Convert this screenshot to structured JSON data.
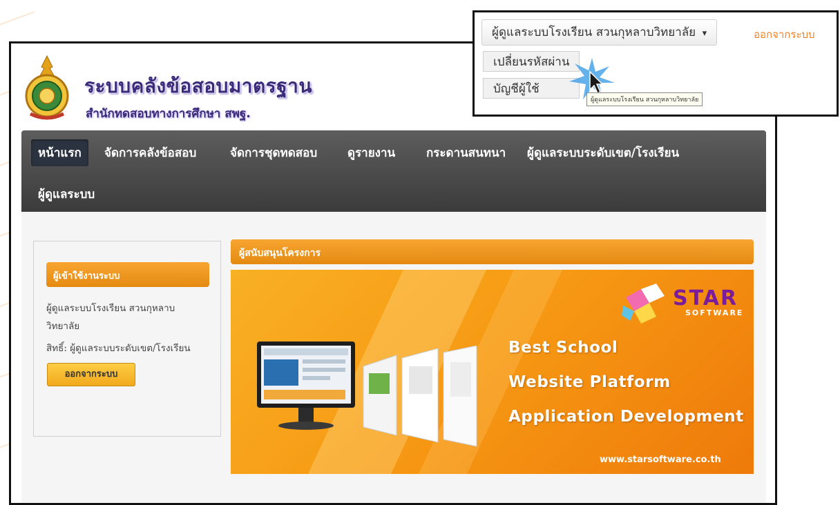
{
  "header": {
    "title": "ระบบคลังข้อสอบมาตรฐาน",
    "subtitle": "สำนักทดสอบทางการศึกษา สพฐ."
  },
  "nav": {
    "items": [
      {
        "label": "หน้าแรก",
        "active": true
      },
      {
        "label": "จัดการคลังข้อสอบ"
      },
      {
        "label": "จัดการชุดทดสอบ"
      },
      {
        "label": "ดูรายงาน"
      },
      {
        "label": "กระดานสนทนา"
      },
      {
        "label": "ผู้ดูแลระบบระดับเขต/โรงเรียน"
      },
      {
        "label": "ผู้ดูแลระบบ"
      }
    ]
  },
  "user_menu": {
    "username": "ผู้ดูแลระบบโรงเรียน สวนกุหลาบวิทยาลัย",
    "caret": "▾",
    "logout_label": "ออกจากระบบ",
    "items": [
      "เปลี่ยนรหัสผ่าน",
      "บัญชีผู้ใช้"
    ],
    "tooltip": "ผู้ดูแลระบบโรงเรียน สวนกุหลาบวิทยาลัย"
  },
  "login_panel": {
    "header": "ผู้เข้าใช้งานระบบ",
    "user_line1": "ผู้ดูแลระบบโรงเรียน สวนกุหลาบ",
    "user_line2": "วิทยาลัย",
    "role": "สิทธิ์: ผู้ดูแลระบบระดับเขต/โรงเรียน",
    "logout_button": "ออกจากระบบ"
  },
  "sponsor": {
    "header": "ผู้สนับสนุนโครงการ",
    "brand": "STAR",
    "brand_sub": "SOFTWARE",
    "lines": [
      "Best School",
      "Website Platform",
      "Application Development"
    ],
    "url": "www.starsoftware.co.th"
  },
  "colors": {
    "accent_orange": "#f29a1c",
    "navbar_dark": "#4a4a4a",
    "title_purple": "#3b2a7a"
  }
}
